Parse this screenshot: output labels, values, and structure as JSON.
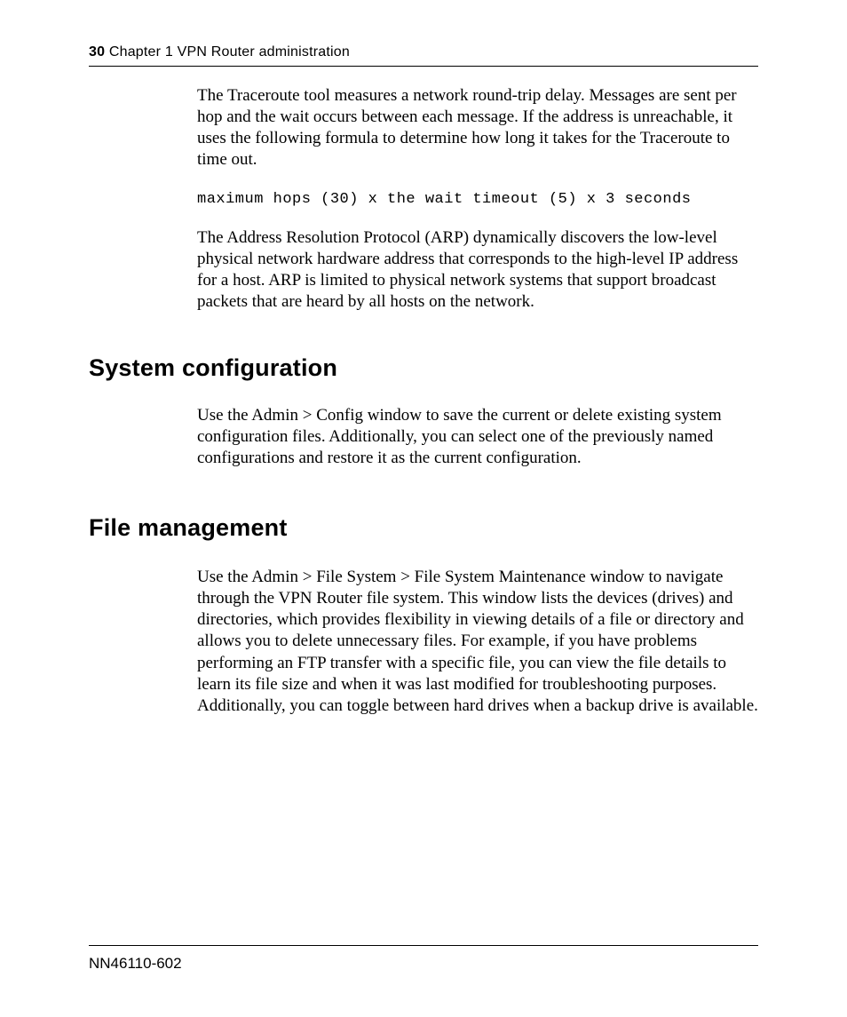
{
  "header": {
    "page_number": "30",
    "chapter": "Chapter 1  VPN Router administration"
  },
  "body": {
    "p1": "The Traceroute tool measures a network round-trip delay. Messages are sent per hop and the wait occurs between each message. If the address is unreachable, it uses the following formula to determine how long it takes for the Traceroute to time out.",
    "code": "maximum hops (30) x the wait timeout (5) x 3 seconds",
    "p2": "The Address Resolution Protocol (ARP) dynamically discovers the low-level physical network hardware address that corresponds to the high-level IP address for a host. ARP is limited to physical network systems that support broadcast packets that are heard by all hosts on the network."
  },
  "sections": {
    "sysconf": {
      "heading": "System configuration",
      "p": "Use the Admin > Config window to save the current or delete existing system configuration files. Additionally, you can select one of the previously named configurations and restore it as the current configuration."
    },
    "filemgmt": {
      "heading": "File management",
      "p": "Use the Admin > File System > File System Maintenance window to navigate through the VPN Router file system. This window lists the devices (drives) and directories, which provides flexibility in viewing details of a file or directory and allows you to delete unnecessary files. For example, if you have problems performing an FTP transfer with a specific file, you can view the file details to learn its file size and when it was last modified for troubleshooting purposes. Additionally, you can toggle between hard drives when a backup drive is available."
    }
  },
  "footer": {
    "doc_number": "NN46110-602"
  }
}
